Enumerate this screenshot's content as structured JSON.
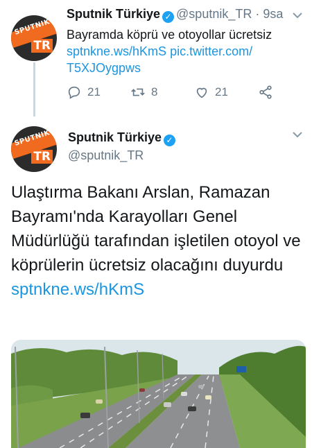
{
  "tweet1": {
    "name": "Sputnik Türkiye",
    "handle": "@sputnik_TR",
    "time": "· 9sa",
    "text": "Bayramda köprü ve otoyollar ücretsiz",
    "link1": "sptnkne.ws/hKmS",
    "link2": "pic.twitter.com/",
    "link3": "T5XJOygpws",
    "replies": "21",
    "retweets": "8",
    "likes": "21"
  },
  "tweet2": {
    "name": "Sputnik Türkiye",
    "handle": "@sputnik_TR",
    "text": "Ulaştırma Bakanı Arslan, Ramazan Bayramı'nda Karayolları Genel Müdürlüğü tarafından işletilen otoyol ve köprülerin ücretsiz olacağını duyurdu",
    "link": "sptnkne.ws/hKmS"
  },
  "avatar": {
    "brand": "SPUTNIK",
    "badge": "TR"
  },
  "icons": [
    "verified-icon",
    "chevron-down-icon",
    "reply-icon",
    "retweet-icon",
    "like-icon",
    "share-icon"
  ],
  "colors": {
    "link": "#1b95e0",
    "verified": "#1da1f2",
    "brand_orange": "#f06a20"
  }
}
